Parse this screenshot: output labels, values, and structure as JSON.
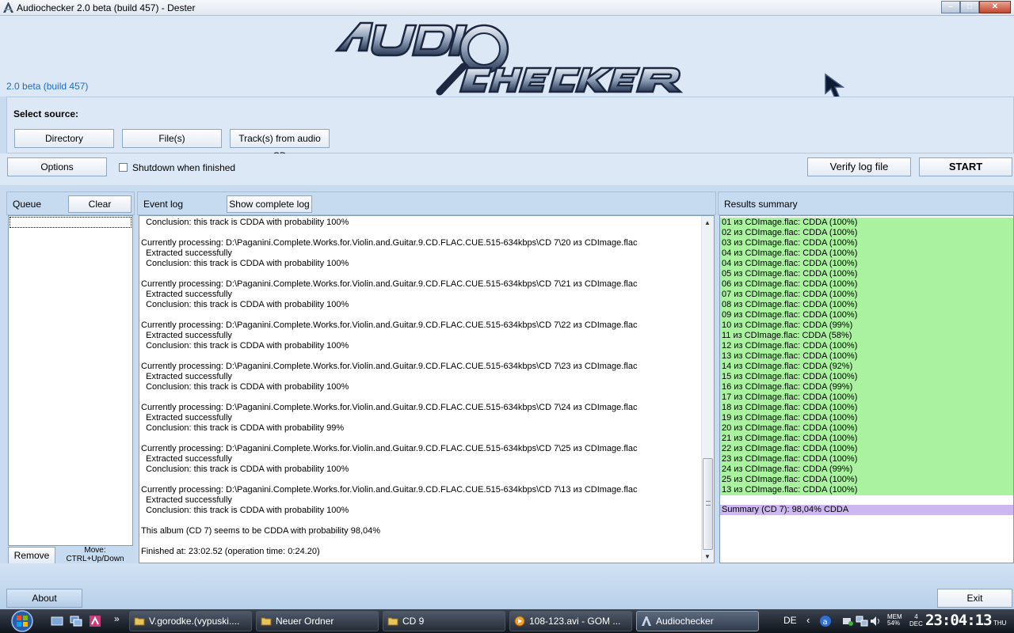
{
  "window": {
    "title": "Audiochecker 2.0 beta (build 457) - Dester",
    "version_label": "2.0 beta (build 457)",
    "buttons": [
      "–",
      "□",
      "✕"
    ]
  },
  "source": {
    "label": "Select source:",
    "directory_label": "Directory",
    "files_label": "File(s)",
    "audiocd_label": "Track(s) from audio CD"
  },
  "options": {
    "options_label": "Options",
    "shutdown_label": "Shutdown when finished",
    "shutdown_checked": false,
    "verify_label": "Verify log file",
    "start_label": "START"
  },
  "queue": {
    "title": "Queue",
    "clear_label": "Clear",
    "remove_label": "Remove",
    "move_hint_line1": "Move:",
    "move_hint_line2": "CTRL+Up/Down"
  },
  "eventlog": {
    "title": "Event log",
    "show_label": "Show complete log",
    "lines": [
      "  Conclusion: this track is CDDA with probability 100%",
      "",
      "Currently processing: D:\\Paganini.Complete.Works.for.Violin.and.Guitar.9.CD.FLAC.CUE.515-634kbps\\CD 7\\20 из CDImage.flac",
      "  Extracted successfully",
      "  Conclusion: this track is CDDA with probability 100%",
      "",
      "Currently processing: D:\\Paganini.Complete.Works.for.Violin.and.Guitar.9.CD.FLAC.CUE.515-634kbps\\CD 7\\21 из CDImage.flac",
      "  Extracted successfully",
      "  Conclusion: this track is CDDA with probability 100%",
      "",
      "Currently processing: D:\\Paganini.Complete.Works.for.Violin.and.Guitar.9.CD.FLAC.CUE.515-634kbps\\CD 7\\22 из CDImage.flac",
      "  Extracted successfully",
      "  Conclusion: this track is CDDA with probability 100%",
      "",
      "Currently processing: D:\\Paganini.Complete.Works.for.Violin.and.Guitar.9.CD.FLAC.CUE.515-634kbps\\CD 7\\23 из CDImage.flac",
      "  Extracted successfully",
      "  Conclusion: this track is CDDA with probability 100%",
      "",
      "Currently processing: D:\\Paganini.Complete.Works.for.Violin.and.Guitar.9.CD.FLAC.CUE.515-634kbps\\CD 7\\24 из CDImage.flac",
      "  Extracted successfully",
      "  Conclusion: this track is CDDA with probability 99%",
      "",
      "Currently processing: D:\\Paganini.Complete.Works.for.Violin.and.Guitar.9.CD.FLAC.CUE.515-634kbps\\CD 7\\25 из CDImage.flac",
      "  Extracted successfully",
      "  Conclusion: this track is CDDA with probability 100%",
      "",
      "Currently processing: D:\\Paganini.Complete.Works.for.Violin.and.Guitar.9.CD.FLAC.CUE.515-634kbps\\CD 7\\13 из CDImage.flac",
      "  Extracted successfully",
      "  Conclusion: this track is CDDA with probability 100%",
      "",
      "This album (CD 7) seems to be CDDA with probability 98,04%",
      "",
      "Finished at: 23:02.52 (operation time: 0:24.20)"
    ]
  },
  "results": {
    "title": "Results summary",
    "items": [
      "01 из CDImage.flac: CDDA (100%)",
      "02 из CDImage.flac: CDDA (100%)",
      "03 из CDImage.flac: CDDA (100%)",
      "04 из CDImage.flac: CDDA (100%)",
      "04 из CDImage.flac: CDDA (100%)",
      "05 из CDImage.flac: CDDA (100%)",
      "06 из CDImage.flac: CDDA (100%)",
      "07 из CDImage.flac: CDDA (100%)",
      "08 из CDImage.flac: CDDA (100%)",
      "09 из CDImage.flac: CDDA (100%)",
      "10 из CDImage.flac: CDDA (99%)",
      "11 из CDImage.flac: CDDA (58%)",
      "12 из CDImage.flac: CDDA (100%)",
      "13 из CDImage.flac: CDDA (100%)",
      "14 из CDImage.flac: CDDA (92%)",
      "15 из CDImage.flac: CDDA (100%)",
      "16 из CDImage.flac: CDDA (99%)",
      "17 из CDImage.flac: CDDA (100%)",
      "18 из CDImage.flac: CDDA (100%)",
      "19 из CDImage.flac: CDDA (100%)",
      "20 из CDImage.flac: CDDA (100%)",
      "21 из CDImage.flac: CDDA (100%)",
      "22 из CDImage.flac: CDDA (100%)",
      "23 из CDImage.flac: CDDA (100%)",
      "24 из CDImage.flac: CDDA (99%)",
      "25 из CDImage.flac: CDDA (100%)",
      "13 из CDImage.flac: CDDA (100%)"
    ],
    "summary": "Summary (CD 7): 98,04% CDDA",
    "ok_color": "#aaf2a0",
    "summary_color": "#cdb7f0"
  },
  "footer": {
    "about_label": "About",
    "exit_label": "Exit"
  },
  "taskbar": {
    "tasks": [
      {
        "label": "V.gorodke.(vypuski....",
        "icon": "folder-icon"
      },
      {
        "label": "Neuer Ordner",
        "icon": "folder-icon"
      },
      {
        "label": "CD 9",
        "icon": "folder-icon"
      },
      {
        "label": "108-123.avi - GOM ...",
        "icon": "media-player-icon"
      },
      {
        "label": "Audiochecker",
        "icon": "audiochecker-icon"
      }
    ],
    "lang": "DE",
    "mem_label": "MEM",
    "mem_value": "54%",
    "date_day": "4",
    "date_month": "DEC",
    "clock": "23:04:13",
    "weekday": "THU"
  }
}
